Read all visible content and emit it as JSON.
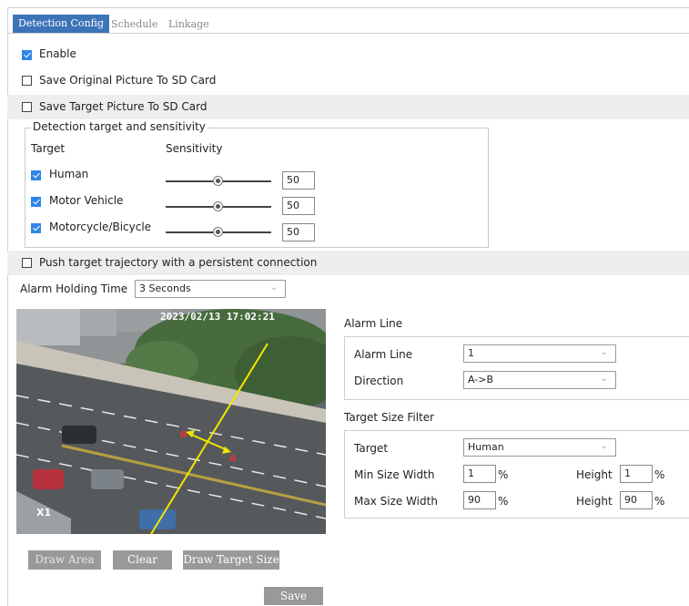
{
  "tabs": {
    "detection": "Detection Config",
    "schedule": "Schedule",
    "linkage": "Linkage"
  },
  "enable": {
    "label": "Enable",
    "checked": true
  },
  "save_original": {
    "label": "Save Original Picture To SD Card",
    "checked": false
  },
  "save_target": {
    "label": "Save Target Picture To SD Card",
    "checked": false
  },
  "detection_group": {
    "title": "Detection target and sensitivity",
    "col_target": "Target",
    "col_sensitivity": "Sensitivity",
    "items": [
      {
        "label": "Human",
        "checked": true,
        "value": "50"
      },
      {
        "label": "Motor Vehicle",
        "checked": true,
        "value": "50"
      },
      {
        "label": "Motorcycle/Bicycle",
        "checked": true,
        "value": "50"
      }
    ]
  },
  "push_trajectory": {
    "label": "Push target trajectory with a persistent connection",
    "checked": false
  },
  "alarm_holding": {
    "label": "Alarm Holding Time",
    "value": "3 Seconds"
  },
  "video": {
    "timestamp": "2023/02/13 17:02:21",
    "channel": "X1",
    "marker_a": "A",
    "marker_b": "B"
  },
  "alarm_line": {
    "title": "Alarm Line",
    "line_label": "Alarm Line",
    "line_value": "1",
    "direction_label": "Direction",
    "direction_value": "A->B"
  },
  "target_size": {
    "title": "Target Size Filter",
    "target_label": "Target",
    "target_value": "Human",
    "min_label": "Min Size Width",
    "min_width": "1",
    "min_height": "1",
    "max_label": "Max Size Width",
    "max_width": "90",
    "max_height": "90",
    "height_label": "Height",
    "unit": "%"
  },
  "buttons": {
    "draw_area": "Draw Area",
    "clear": "Clear",
    "draw_target": "Draw Target Size",
    "save": "Save"
  }
}
